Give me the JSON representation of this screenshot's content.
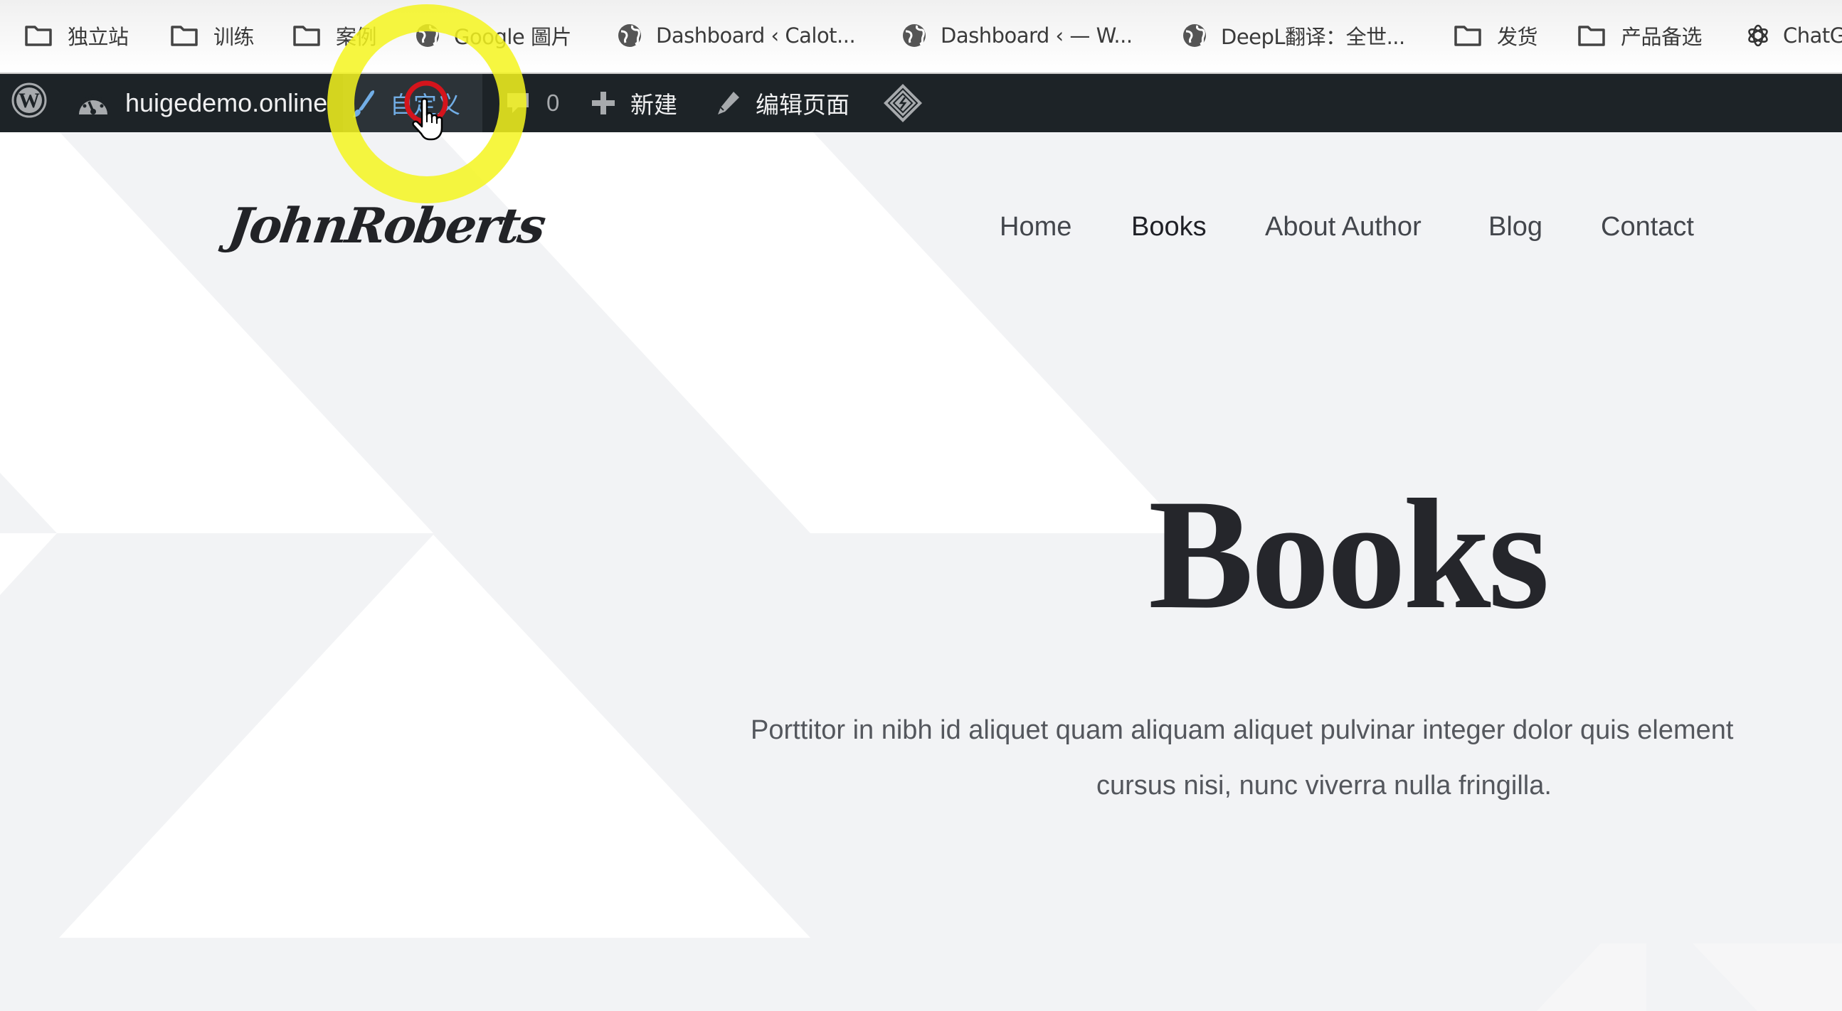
{
  "bookmarks_bar": {
    "items": [
      {
        "icon": "folder-icon",
        "label": "独立站"
      },
      {
        "icon": "folder-icon",
        "label": "训练"
      },
      {
        "icon": "folder-icon",
        "label": "案例"
      },
      {
        "icon": "globe-icon",
        "label": "Google 圖片"
      },
      {
        "icon": "globe-icon",
        "label": "Dashboard ‹ Calot..."
      },
      {
        "icon": "globe-icon",
        "label": "Dashboard ‹ — W..."
      },
      {
        "icon": "globe-icon",
        "label": "DeepL翻译：全世..."
      },
      {
        "icon": "folder-icon",
        "label": "发货"
      },
      {
        "icon": "folder-icon",
        "label": "产品备选"
      },
      {
        "icon": "openai-icon",
        "label": "ChatG"
      }
    ]
  },
  "admin_bar": {
    "wp_logo": "wordpress-logo-icon",
    "site_name": "huigedemo.online",
    "customize": "自定义",
    "comments_count": "0",
    "new": "新建",
    "edit_page": "编辑页面",
    "extra_icon": "diamond-plugin-icon",
    "hover_color": "#72aee6"
  },
  "site": {
    "logo_text": "JohnRoberts",
    "nav": [
      {
        "label": "Home",
        "active": false
      },
      {
        "label": "Books",
        "active": true
      },
      {
        "label": "About Author",
        "active": false
      },
      {
        "label": "Blog",
        "active": false
      },
      {
        "label": "Contact",
        "active": false
      }
    ],
    "hero": {
      "title": "Books",
      "text_line1": "Porttitor in nibh id aliquet quam aliquam aliquet pulvinar integer dolor quis element",
      "text_line2": "cursus nisi, nunc viverra nulla fringilla."
    },
    "colors": {
      "background": "#f2f3f5",
      "shape": "#ffffff",
      "admin_bar": "#1d2327",
      "heading": "#25262b"
    }
  },
  "cursor_highlight": {
    "ring_color": "#f5f51e",
    "click_color": "#d4141c"
  }
}
